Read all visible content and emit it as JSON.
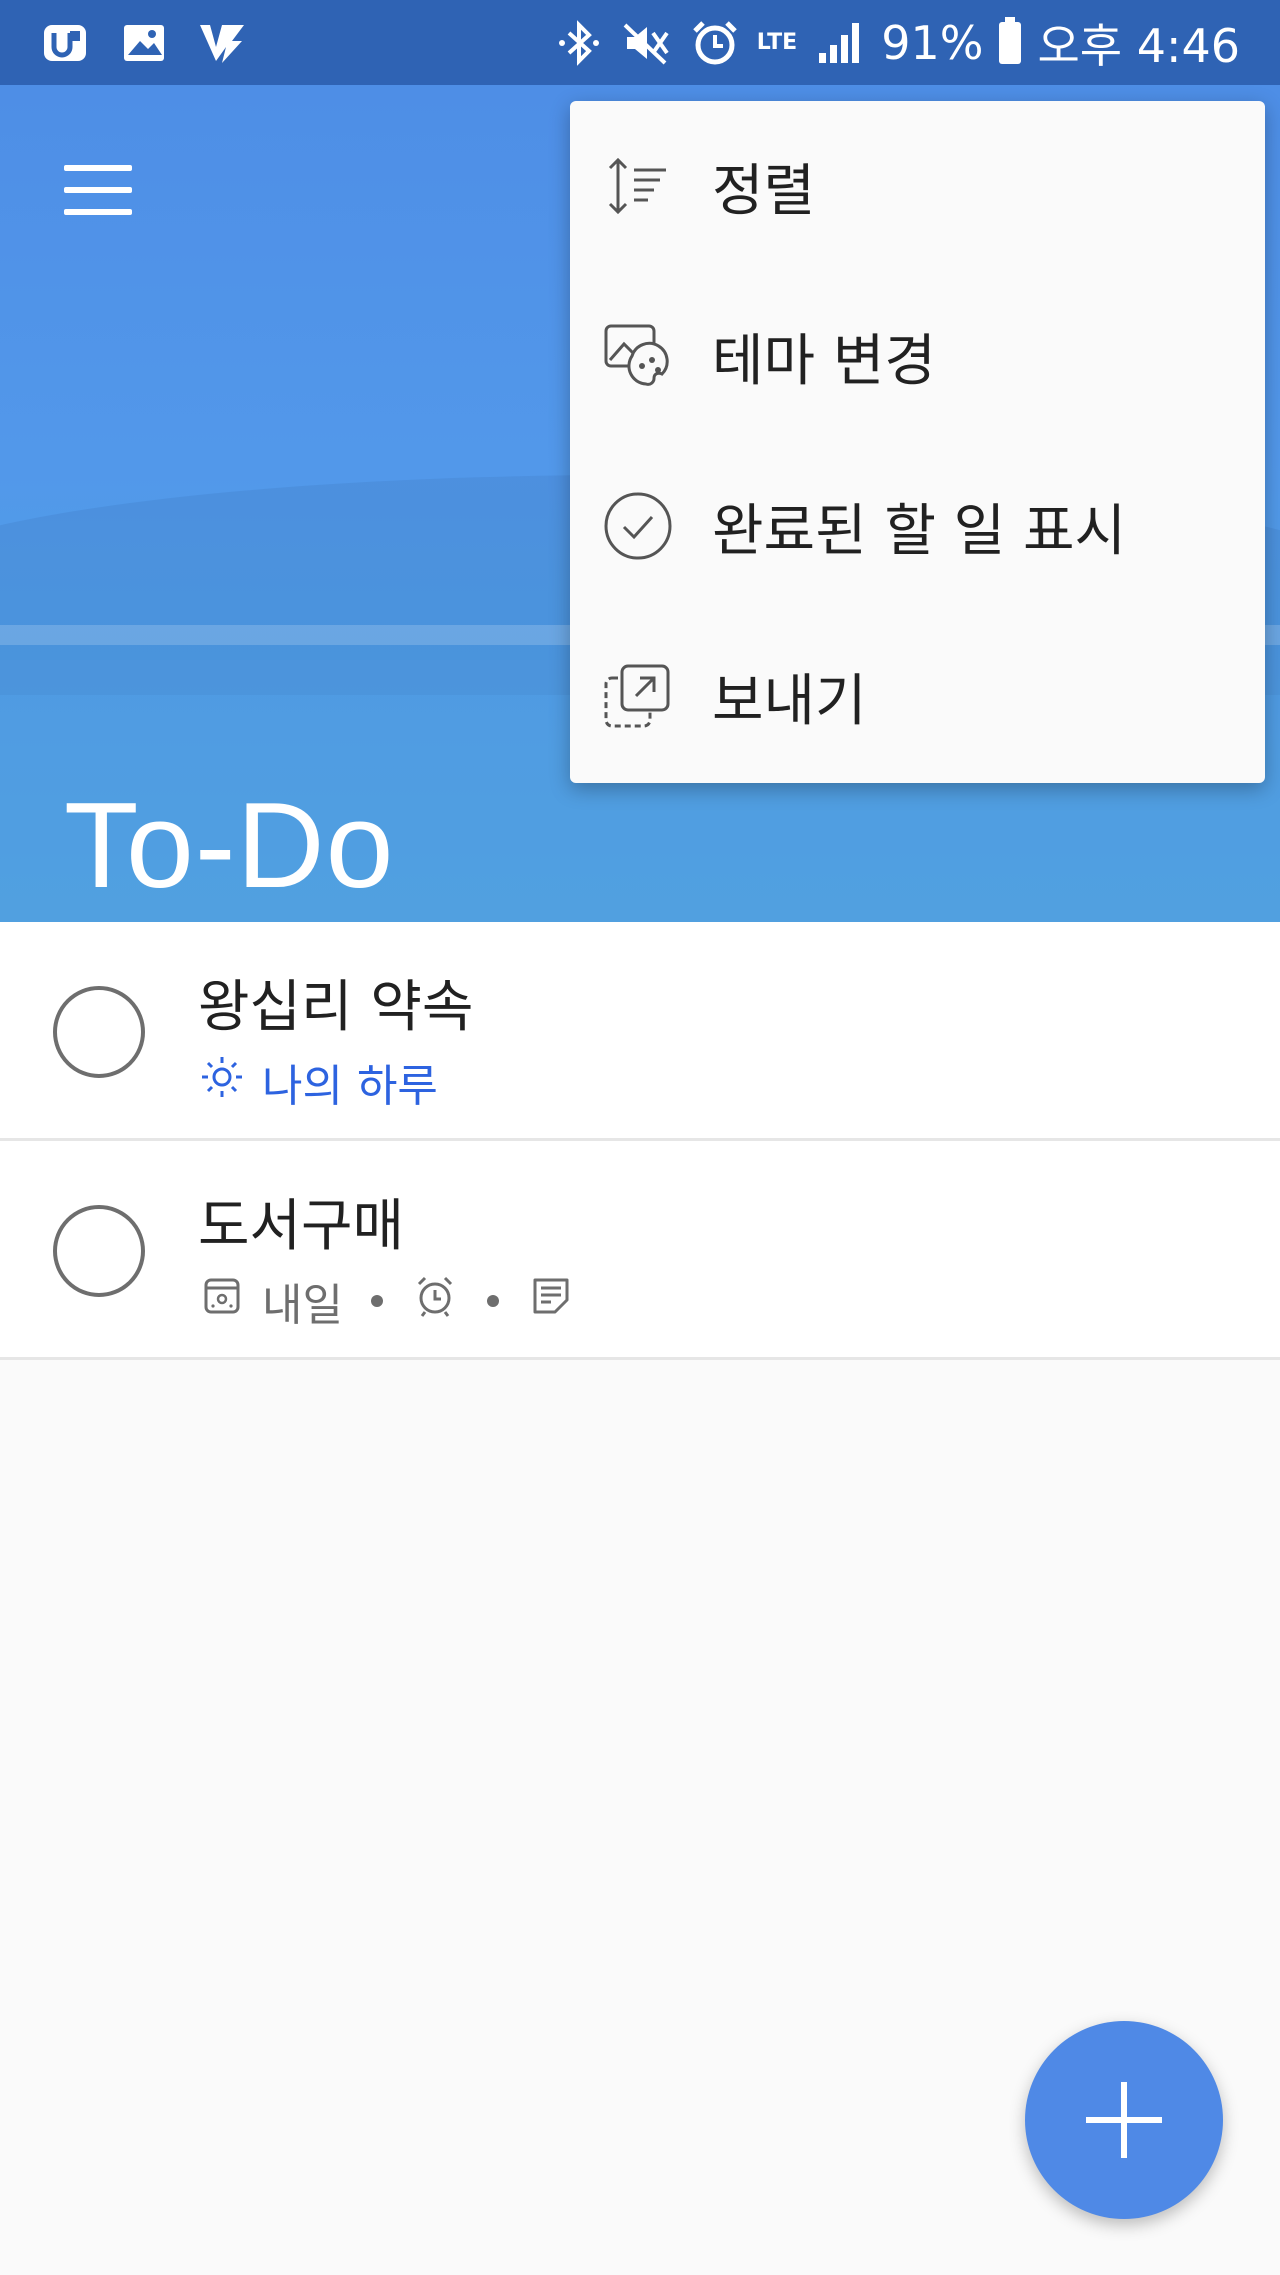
{
  "status_bar": {
    "battery": "91%",
    "network": "LTE",
    "time": "오후 4:46"
  },
  "header": {
    "title": "To-Do"
  },
  "tasks": [
    {
      "title": "왕십리 약속",
      "meta_label": "나의 하루"
    },
    {
      "title": "도서구매",
      "meta_label": "내일"
    }
  ],
  "menu": {
    "items": [
      {
        "label": "정렬",
        "icon": "sort-icon"
      },
      {
        "label": "테마 변경",
        "icon": "theme-icon"
      },
      {
        "label": "완료된 할 일 표시",
        "icon": "check-circle-icon"
      },
      {
        "label": "보내기",
        "icon": "share-icon"
      }
    ]
  },
  "colors": {
    "status_bar": "#2f63b4",
    "header": "#5298ea",
    "accent_blue": "#2d63e0",
    "fab": "#4f89e6"
  }
}
